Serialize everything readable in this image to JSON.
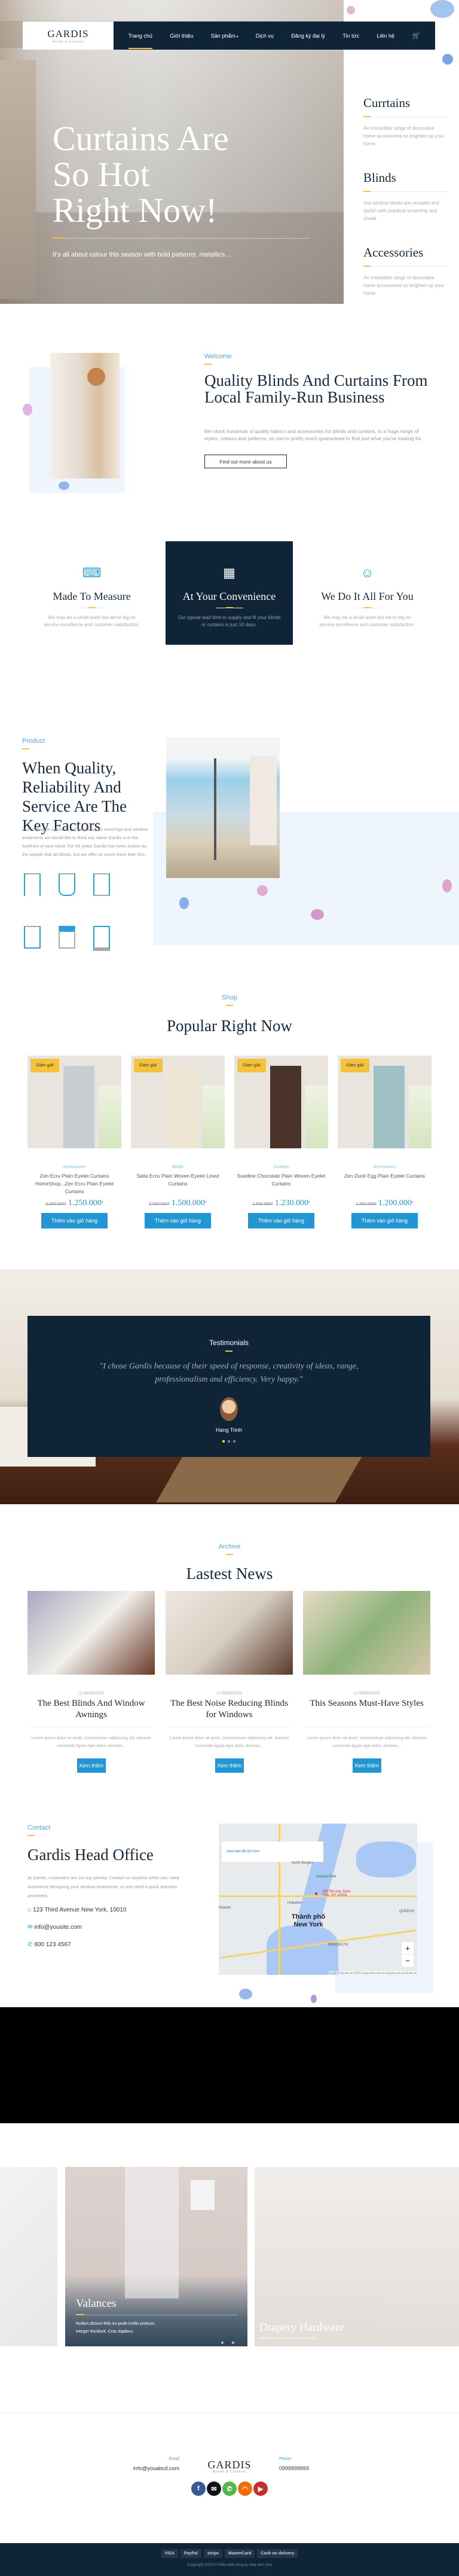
{
  "nav": {
    "logo_name": "GARDIS",
    "logo_tagline": "Blinds & Curtains",
    "items": [
      "Trang chủ",
      "Giới thiệu",
      "Sản phẩm",
      "Dịch vụ",
      "Đăng ký đại lý",
      "Tin tức",
      "Liên hệ"
    ],
    "active": "Trang chủ",
    "dropdown_item": "Sản phẩm",
    "cart_icon": "cart-icon"
  },
  "hero": {
    "title": "Curtains Are So Hot Right Now!",
    "subtitle": "It's all about colour this season with bold patterns, metallics..."
  },
  "sidebar": [
    {
      "title": "Currtains",
      "text": "An irresistible range of decorative home accessories so brighten up your home"
    },
    {
      "title": "Blinds",
      "text": "Our window blinds are versatile and stylish with practical screening and shade"
    },
    {
      "title": "Accessories",
      "text": "An irresistible range of decorative home accessories so brighten up your home"
    }
  ],
  "welcome": {
    "label": "Welcome",
    "title": "Quality Blinds And Curtains From Local Family-Run Business",
    "text": "We stock hundreds of quality fabrics and accessories for blinds and curtains, in a huge range of styles, colours and patterns, so you're pretty much guaranteed to find just what you're looking for.",
    "button": "Find out more about us"
  },
  "features": [
    {
      "icon": "sewing-machine-icon",
      "title": "Made To Measure",
      "text": "We may be a small team but we're big on service excellence and customer satisfaction."
    },
    {
      "icon": "calendar-icon",
      "title": "At Your Convenience",
      "text": "Our typical lead time to supply and fit your blinds or curtains is just 10 days."
    },
    {
      "icon": "support-agent-icon",
      "title": "We Do It All For You",
      "text": "We may be a small team but we're big on service excellence and customer satisfaction."
    }
  ],
  "product": {
    "label": "Product",
    "title": "When Quality, Reliability And Service Are The Key Factors",
    "text": "In deciding on a provider of your window coverings and window treatments we would like to think our name Gardis is in the forefront of your mind. For 45 years Gardis has been known as the people that do blinds, but we offer so much more than this.",
    "icons": [
      "pleated-curtain-icon",
      "tied-curtain-icon",
      "crossed-curtain-icon",
      "panel-curtain-icon",
      "valance-icon",
      "roman-blind-icon"
    ]
  },
  "shop": {
    "label": "Shop",
    "title": "Popular Right Now",
    "products": [
      {
        "badge": "Giảm giá!",
        "category": "Accessories",
        "name": "Zen Ecru Plain Eyelet Curtains HomeShop...Zen Ecru Plain Eyelet Curtains",
        "old_price": "3.200.000₫",
        "price": "1.250.000",
        "currency": "₫",
        "button": "Thêm vào giỏ hàng",
        "color": "#c9ced3"
      },
      {
        "badge": "Giảm giá!",
        "category": "Blinds",
        "name": "Salla Ecru Plain Woven Eyelet Lined Curtains",
        "old_price": "2.000.000₫",
        "price": "1.500.000",
        "currency": "₫",
        "button": "Thêm vào giỏ hàng",
        "color": "#efe6d6"
      },
      {
        "badge": "Giảm giá!",
        "category": "Curtains",
        "name": "Suedine Chocolate Plain Woven Eyelet Curtains",
        "old_price": "1.500.000₫",
        "price": "1.230.000",
        "currency": "₫",
        "button": "Thêm vào giỏ hàng",
        "color": "#4a342a"
      },
      {
        "badge": "Giảm giá!",
        "category": "Accessories",
        "name": "Zen Duck Egg Plain Eyelet Curtains",
        "old_price": "1.250.000₫",
        "price": "1.200.000",
        "currency": "₫",
        "button": "Thêm vào giỏ hàng",
        "color": "#9fc1c4"
      }
    ]
  },
  "testimonial": {
    "label": "Testimonials",
    "quote": "\"I chose Gardis because of their speed of response, creativity of ideas, range, professionalism and efficiency. Very happy.\"",
    "name": "Hang Trinh",
    "active_dot": 1,
    "dot_count": 3
  },
  "news": {
    "label": "Archive",
    "title": "Lastest News",
    "posts": [
      {
        "date": "09/06/2022",
        "title": "The Best Blinds And Window Awnings",
        "excerpt": "Lorem ipsum dolor sit amet, consectetuer adipiscing elit. Aenean commodo ligula eget dolor. Aenean...",
        "button": "Xem thêm"
      },
      {
        "date": "09/06/2022",
        "title": "The Best Noise Reducing Blinds for Windows",
        "excerpt": "Lorem ipsum dolor sit amet, consectetuer adipiscing elit. Aenean commodo ligula eget dolor. Aenean...",
        "button": "Xem thêm"
      },
      {
        "date": "09/06/2022",
        "title": "This Seasons Must-Have Styles",
        "excerpt": "Lorem ipsum dolor sit amet, consectetuer adipiscing elit. Aenean commodo ligula eget dolor. Aenean...",
        "button": "Xem thêm"
      }
    ]
  },
  "contact": {
    "label": "Contact",
    "title": "Gardis Head Office",
    "text": "At Gardis, customers are our top priority. Contact us anytime when you need assistance designing your window treatments, or just need a quick question answered.",
    "address": "123 Third Avenue New York, 10010",
    "email": "info@yousite.com",
    "phone": "800 123 4567",
    "map": {
      "link": "Xem bản đồ lớn hơn",
      "pin": "350 5th Ave, New York, NY 10118",
      "city": "Thành phố New York",
      "places": [
        "Newark",
        "Hoboken",
        "Central Park",
        "North Bergen",
        "BROOKLYN",
        "QUEENS"
      ],
      "zoom_in": "+",
      "zoom_out": "−",
      "footer": "Phím tắt  Dữ liệu bản đồ ©2023 Google  Điều khoản sử dụng  Báo cáo một lỗi bản đồ"
    }
  },
  "slider": {
    "cards": [
      {
        "title": "Valances",
        "text": "Nullam dictum felis eu pede mollis pretium. Integer tincidunt. Cras dapibus."
      },
      {
        "title": "Drapery Hardware",
        "text": "Nullam dictum felis eu pede mollis pretium."
      }
    ],
    "active_dot": 1,
    "dot_count": 3
  },
  "footer": {
    "email_label": "Email",
    "email": "info@youabcd.com",
    "phone_label": "Phone",
    "phone": "0999999999",
    "logo_name": "GARDIS",
    "logo_tagline": "Blinds & Curtains",
    "socials": [
      {
        "icon": "facebook-icon",
        "glyph": "f",
        "color": "#3b5998"
      },
      {
        "icon": "email-icon",
        "glyph": "✉",
        "color": "#111111"
      },
      {
        "icon": "phone-icon",
        "glyph": "✆",
        "color": "#51b847"
      },
      {
        "icon": "rss-icon",
        "glyph": "◠",
        "color": "#f26c0d"
      },
      {
        "icon": "youtube-icon",
        "glyph": "▶",
        "color": "#c4302b"
      }
    ],
    "payments": [
      "VISA",
      "PayPal",
      "stripe",
      "MasterCard",
      "Cash on delivery"
    ],
    "copyright": "Copyright 2023 © Mẫu web công ty may rèm cửa"
  },
  "colors": {
    "navy": "#0f2537",
    "accent": "#2196d3",
    "yellow": "#f5c33b",
    "label": "#4aa9e0"
  }
}
